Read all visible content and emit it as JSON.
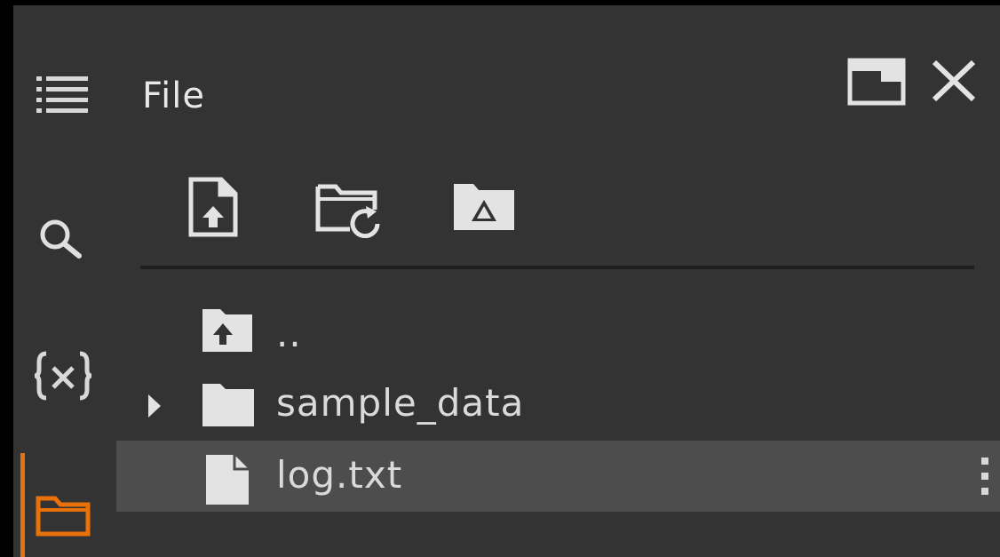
{
  "panel": {
    "title": "File"
  },
  "sidebar": {
    "items": [
      {
        "name": "table-of-contents",
        "icon": "list-icon"
      },
      {
        "name": "search",
        "icon": "search-icon"
      },
      {
        "name": "variables",
        "icon": "variables-icon"
      },
      {
        "name": "files",
        "icon": "folder-icon",
        "active": true
      }
    ]
  },
  "header": {
    "buttons": [
      {
        "name": "maximize",
        "icon": "window-icon"
      },
      {
        "name": "close",
        "icon": "close-icon"
      }
    ]
  },
  "toolbar": {
    "buttons": [
      {
        "name": "upload",
        "icon": "file-upload-icon"
      },
      {
        "name": "refresh",
        "icon": "folder-refresh-icon"
      },
      {
        "name": "mount-drive",
        "icon": "drive-folder-icon"
      }
    ]
  },
  "files": {
    "items": [
      {
        "label": "..",
        "type": "parent"
      },
      {
        "label": "sample_data",
        "type": "folder",
        "collapsed": true
      },
      {
        "label": "log.txt",
        "type": "file",
        "selected": true
      }
    ]
  },
  "colors": {
    "background": "#333333",
    "selected_row": "#4d4d4d",
    "accent": "#e8710a",
    "icon": "#e3e3e3",
    "text": "#dadada"
  }
}
